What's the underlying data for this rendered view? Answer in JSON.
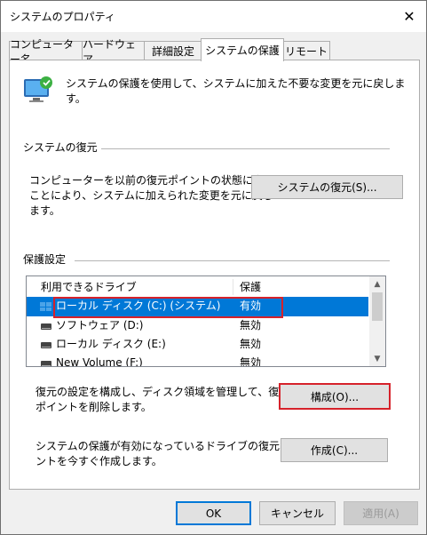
{
  "window": {
    "title": "システムのプロパティ"
  },
  "tabs": [
    {
      "label": "コンピューター名"
    },
    {
      "label": "ハードウェア"
    },
    {
      "label": "詳細設定"
    },
    {
      "label": "システムの保護"
    },
    {
      "label": "リモート"
    }
  ],
  "intro": {
    "line1": "システムの保護を使用して、システムに加えた不要な変更を元に戻しま",
    "line2": "す。"
  },
  "restore": {
    "heading": "システムの復元",
    "line1": "コンピューターを以前の復元ポイントの状態に戻す",
    "line2": "ことにより、システムに加えられた変更を元に戻し",
    "line3": "ます。",
    "button": "システムの復元(S)..."
  },
  "protection": {
    "heading": "保護設定",
    "columns": {
      "drive": "利用できるドライブ",
      "protect": "保護"
    },
    "drives": [
      {
        "name": "ローカル ディスク (C:) (システム)",
        "status": "有効"
      },
      {
        "name": "ソフトウェア (D:)",
        "status": "無効"
      },
      {
        "name": "ローカル ディスク (E:)",
        "status": "無効"
      },
      {
        "name": "New Volume (F:)",
        "status": "無効"
      }
    ]
  },
  "configure": {
    "line1": "復元の設定を構成し、ディスク領域を管理して、復元",
    "line2": "ポイントを削除します。",
    "button": "構成(O)..."
  },
  "create": {
    "line1": "システムの保護が有効になっているドライブの復元ポイ",
    "line2": "ントを今すぐ作成します。",
    "button": "作成(C)..."
  },
  "footer": {
    "ok": "OK",
    "cancel": "キャンセル",
    "apply": "適用(A)"
  },
  "colors": {
    "selection": "#0078d7",
    "highlight": "#d6222b"
  }
}
